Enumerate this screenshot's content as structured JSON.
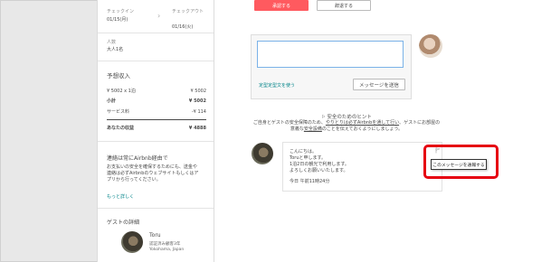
{
  "sidebar": {
    "checkin_label": "チェックイン",
    "checkin_date": "01/15(月)",
    "checkout_label": "チェックアウト",
    "checkout_date": "01/16(火)",
    "guests_label": "人数",
    "guests_value": "大人1名",
    "income_title": "予想収入",
    "nightly_label": "¥ 5002 x 1泊",
    "nightly_value": "¥ 5002",
    "subtotal_label": "小計",
    "subtotal_value": "¥ 5002",
    "service_label": "サービス料",
    "service_value": "-¥ 114",
    "earnings_label": "あなたの収益",
    "earnings_value": "¥ 4888",
    "contact_title": "連絡は常にAirbnb経由で",
    "contact_body": "お支払いの安全を確保するためにも、送金や連絡は必ずAirbnbのウェブサイトもしくはアプリから行ってください。",
    "more_link": "もっと詳しく",
    "guest_details_title": "ゲストの詳細",
    "guest_name": "Toru",
    "guest_verified": "認証済み顧客3年",
    "guest_location": "Yokohama, Japan"
  },
  "top_buttons": {
    "accept": "承認する",
    "decline": "辞退する"
  },
  "reply": {
    "template_link": "定型定型文を使う",
    "send_button": "メッセージを送信"
  },
  "safety": {
    "title": "安全のためのヒント",
    "body_1": "ご自身とゲストの安全保障のため、",
    "body_link": "やりとりは必ずAirbnbを通して行い",
    "body_2": "、ゲストにお部屋の",
    "body_3a": "意義な",
    "body_3b": "安全設備",
    "body_3c": "のことを伝えておくようにしましょう。"
  },
  "message": {
    "line1": "こんにちは。",
    "line2": "Toruと申します。",
    "line3": "1泊2日の観光で利用します。",
    "line4": "よろしくお願いいたします。",
    "time": "今日 午前11時24分",
    "report_tooltip": "このメッセージを通報する"
  },
  "colors": {
    "accent": "#ff5a5f",
    "teal": "#008489",
    "highlight": "#e60012"
  }
}
